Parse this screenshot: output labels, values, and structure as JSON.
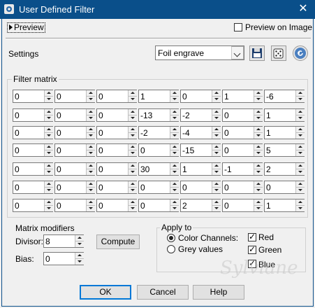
{
  "window": {
    "title": "User Defined Filter",
    "close": "✕"
  },
  "preview": {
    "label": "Preview",
    "on_image_label": "Preview on Image",
    "on_image_checked": false
  },
  "settings": {
    "label": "Settings",
    "preset": "Foil engrave",
    "icons": [
      "save-icon",
      "random-dice-icon",
      "reset-icon"
    ]
  },
  "filter_matrix": {
    "label": "Filter matrix",
    "rows": [
      [
        "0",
        "0",
        "0",
        "1",
        "0",
        "1",
        "-6"
      ],
      [
        "0",
        "0",
        "0",
        "-13",
        "-2",
        "0",
        "1"
      ],
      [
        "0",
        "0",
        "0",
        "-2",
        "-4",
        "0",
        "1"
      ],
      [
        "0",
        "0",
        "0",
        "0",
        "-15",
        "0",
        "5"
      ],
      [
        "0",
        "0",
        "0",
        "30",
        "1",
        "-1",
        "2"
      ],
      [
        "0",
        "0",
        "0",
        "0",
        "0",
        "0",
        "0"
      ],
      [
        "0",
        "0",
        "0",
        "0",
        "2",
        "0",
        "1"
      ]
    ]
  },
  "matrix_modifiers": {
    "label": "Matrix modifiers",
    "divisor_label": "Divisor:",
    "divisor": "8",
    "bias_label": "Bias:",
    "bias": "0",
    "compute_label": "Compute"
  },
  "apply_to": {
    "label": "Apply to",
    "color_channels": "Color Channels:",
    "grey_values": "Grey values",
    "selected": "color_channels",
    "red": "Red",
    "green": "Green",
    "blue": "Blue",
    "red_checked": true,
    "green_checked": true,
    "blue_checked": true
  },
  "buttons": {
    "ok": "OK",
    "cancel": "Cancel",
    "help": "Help"
  },
  "watermark": "Sylviane",
  "colors": {
    "titlebar": "#0a4f8a",
    "focus": "#0078d7"
  }
}
